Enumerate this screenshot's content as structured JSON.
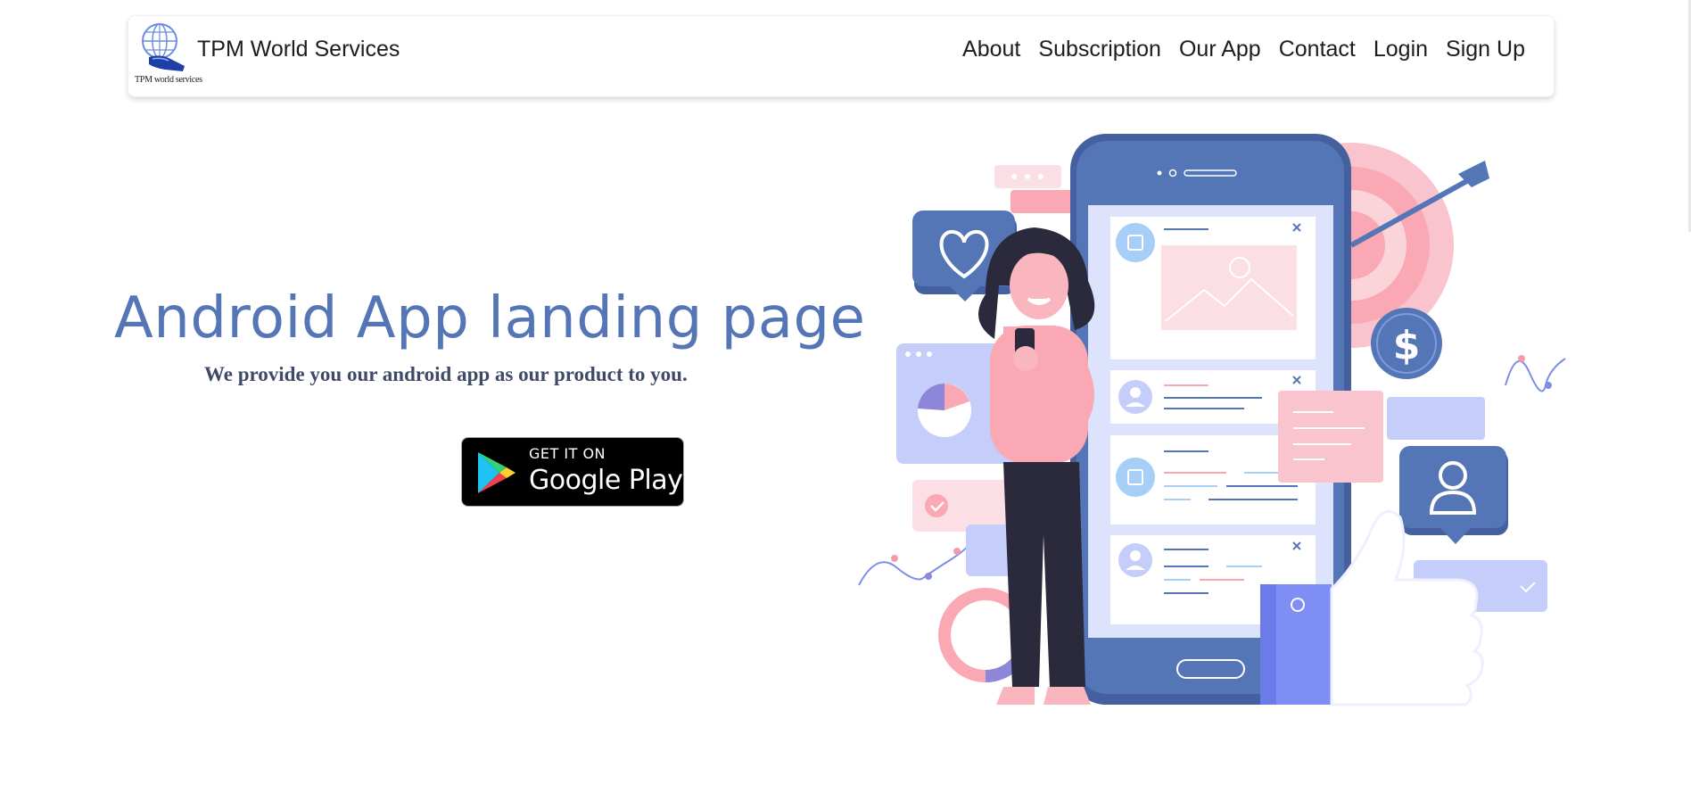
{
  "header": {
    "brand_name": "TPM World Services",
    "logo_caption": "TPM world services",
    "logo_icon": "globe-hand-icon",
    "nav": [
      {
        "label": "About"
      },
      {
        "label": "Subscription"
      },
      {
        "label": "Our App"
      },
      {
        "label": "Contact"
      },
      {
        "label": "Login"
      },
      {
        "label": "Sign Up"
      }
    ]
  },
  "hero": {
    "title": "Android App landing page",
    "subtitle": "We provide you our android app as our product to you.",
    "store_badge": {
      "top_text": "GET IT ON",
      "main_text": "Google Play",
      "icon": "google-play-icon"
    }
  },
  "colors": {
    "accent": "#5576b6",
    "pink": "#f9a8b4",
    "lavender": "#c5cdfb",
    "dark": "#2b2a3c"
  }
}
